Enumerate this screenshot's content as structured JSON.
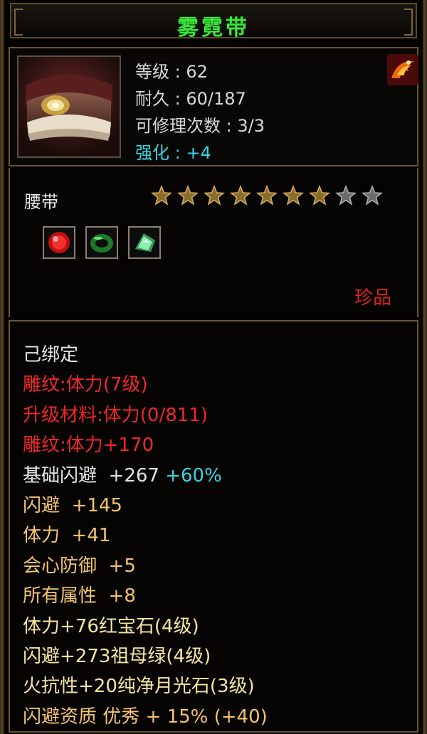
{
  "item": {
    "name": "雾霓带",
    "name_color": "#38e838",
    "icon": "belt-item-icon",
    "corner_icon": "phoenix-badge-icon"
  },
  "stats": {
    "level_label": "等级",
    "level_value": "62",
    "durability_label": "耐久",
    "durability_value": "60/187",
    "repair_label": "可修理次数",
    "repair_value": "3/3",
    "enhance_label": "强化",
    "enhance_value": "+4"
  },
  "category": "腰带",
  "stars": {
    "filled": 7,
    "total": 9
  },
  "gems": [
    {
      "icon": "ruby-gem-icon"
    },
    {
      "icon": "jade-ring-gem-icon"
    },
    {
      "icon": "green-crystal-gem-icon"
    }
  ],
  "quality": "珍品",
  "attributes": [
    {
      "text": "己绑定",
      "color": "white"
    },
    {
      "text": "雕纹:体力(7级)",
      "color": "red"
    },
    {
      "text": "升级材料:体力(0/811)",
      "color": "red"
    },
    {
      "text": "雕纹:体力+170",
      "color": "red"
    },
    {
      "text": "基础闪避  +267",
      "extra": "+60%",
      "color": "white"
    },
    {
      "text": "闪避  +145",
      "color": "gold"
    },
    {
      "text": "体力  +41",
      "color": "gold"
    },
    {
      "text": "会心防御  +5",
      "color": "gold"
    },
    {
      "text": "所有属性  +8",
      "color": "gold"
    },
    {
      "text": "体力+76红宝石(4级)",
      "color": "yellowish"
    },
    {
      "text": "闪避+273祖母绿(4级)",
      "color": "yellowish"
    },
    {
      "text": "火抗性+20纯净月光石(3级)",
      "color": "yellowish"
    },
    {
      "text": "闪避资质 优秀 + 15% (+40)",
      "color": "gold"
    }
  ]
}
